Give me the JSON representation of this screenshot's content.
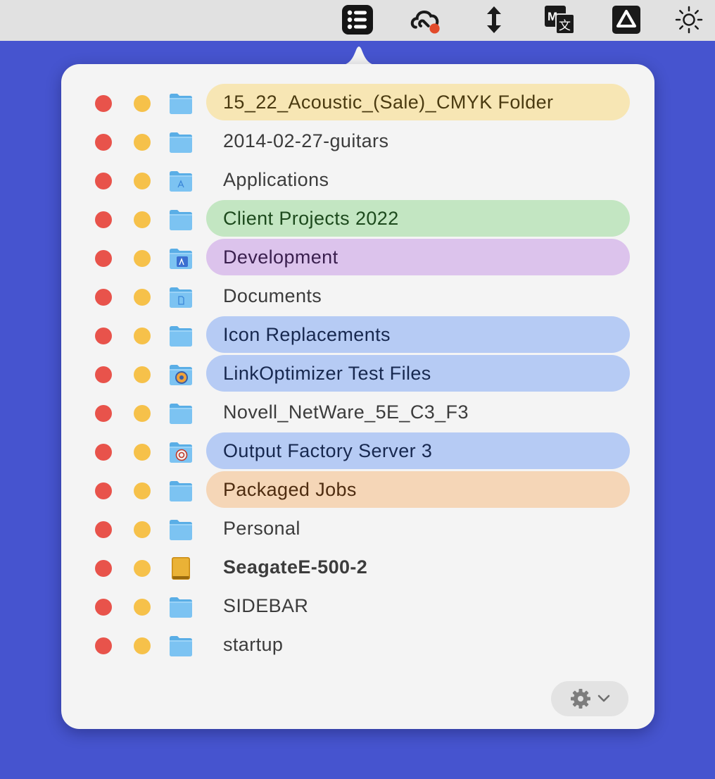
{
  "menubar": {
    "icons": [
      "list-app-icon",
      "creative-cloud-icon",
      "vertical-arrows-icon",
      "translate-icon",
      "google-drive-icon",
      "brightness-icon"
    ]
  },
  "colors": {
    "desktop": "#4654cf",
    "close_dot": "#e8534b",
    "minimize_dot": "#f6c14a",
    "tag_yellow": "#f7e6b4",
    "tag_green": "#c3e6c2",
    "tag_purple": "#dcc3ec",
    "tag_blue": "#b6cbf4",
    "tag_orange": "#f5d6b7"
  },
  "items": [
    {
      "label": "15_22_Acoustic_(Sale)_CMYK Folder",
      "icon": "folder-icon",
      "highlight": "#f7e6b4",
      "text_color": "#4a3a10"
    },
    {
      "label": "2014-02-27-guitars",
      "icon": "folder-icon",
      "highlight": "",
      "text_color": "#3c3c3c"
    },
    {
      "label": "Applications",
      "icon": "applications-folder-icon",
      "highlight": "",
      "text_color": "#3c3c3c"
    },
    {
      "label": "Client Projects 2022",
      "icon": "folder-icon",
      "highlight": "#c3e6c2",
      "text_color": "#1d4a1d"
    },
    {
      "label": "Development",
      "icon": "development-folder-icon",
      "highlight": "#dcc3ec",
      "text_color": "#3a1f4e"
    },
    {
      "label": "Documents",
      "icon": "documents-folder-icon",
      "highlight": "",
      "text_color": "#3c3c3c"
    },
    {
      "label": "Icon Replacements",
      "icon": "folder-icon",
      "highlight": "#b6cbf4",
      "text_color": "#17284f"
    },
    {
      "label": "LinkOptimizer Test Files",
      "icon": "linkoptimizer-folder-icon",
      "highlight": "#b6cbf4",
      "text_color": "#17284f"
    },
    {
      "label": "Novell_NetWare_5E_C3_F3",
      "icon": "folder-icon",
      "highlight": "",
      "text_color": "#3c3c3c"
    },
    {
      "label": "Output Factory Server 3",
      "icon": "output-factory-folder-icon",
      "highlight": "#b6cbf4",
      "text_color": "#17284f"
    },
    {
      "label": "Packaged Jobs",
      "icon": "folder-icon",
      "highlight": "#f5d6b7",
      "text_color": "#4e2c10"
    },
    {
      "label": "Personal",
      "icon": "folder-icon",
      "highlight": "",
      "text_color": "#3c3c3c"
    },
    {
      "label": "SeagateE-500-2",
      "icon": "external-drive-icon",
      "highlight": "",
      "text_color": "#3c3c3c",
      "bold": true
    },
    {
      "label": "SIDEBAR",
      "icon": "folder-icon",
      "highlight": "",
      "text_color": "#3c3c3c"
    },
    {
      "label": "startup",
      "icon": "folder-icon",
      "highlight": "",
      "text_color": "#3c3c3c"
    }
  ],
  "footer": {
    "settings_icon": "gear-icon",
    "menu_icon": "chevron-down-icon"
  }
}
